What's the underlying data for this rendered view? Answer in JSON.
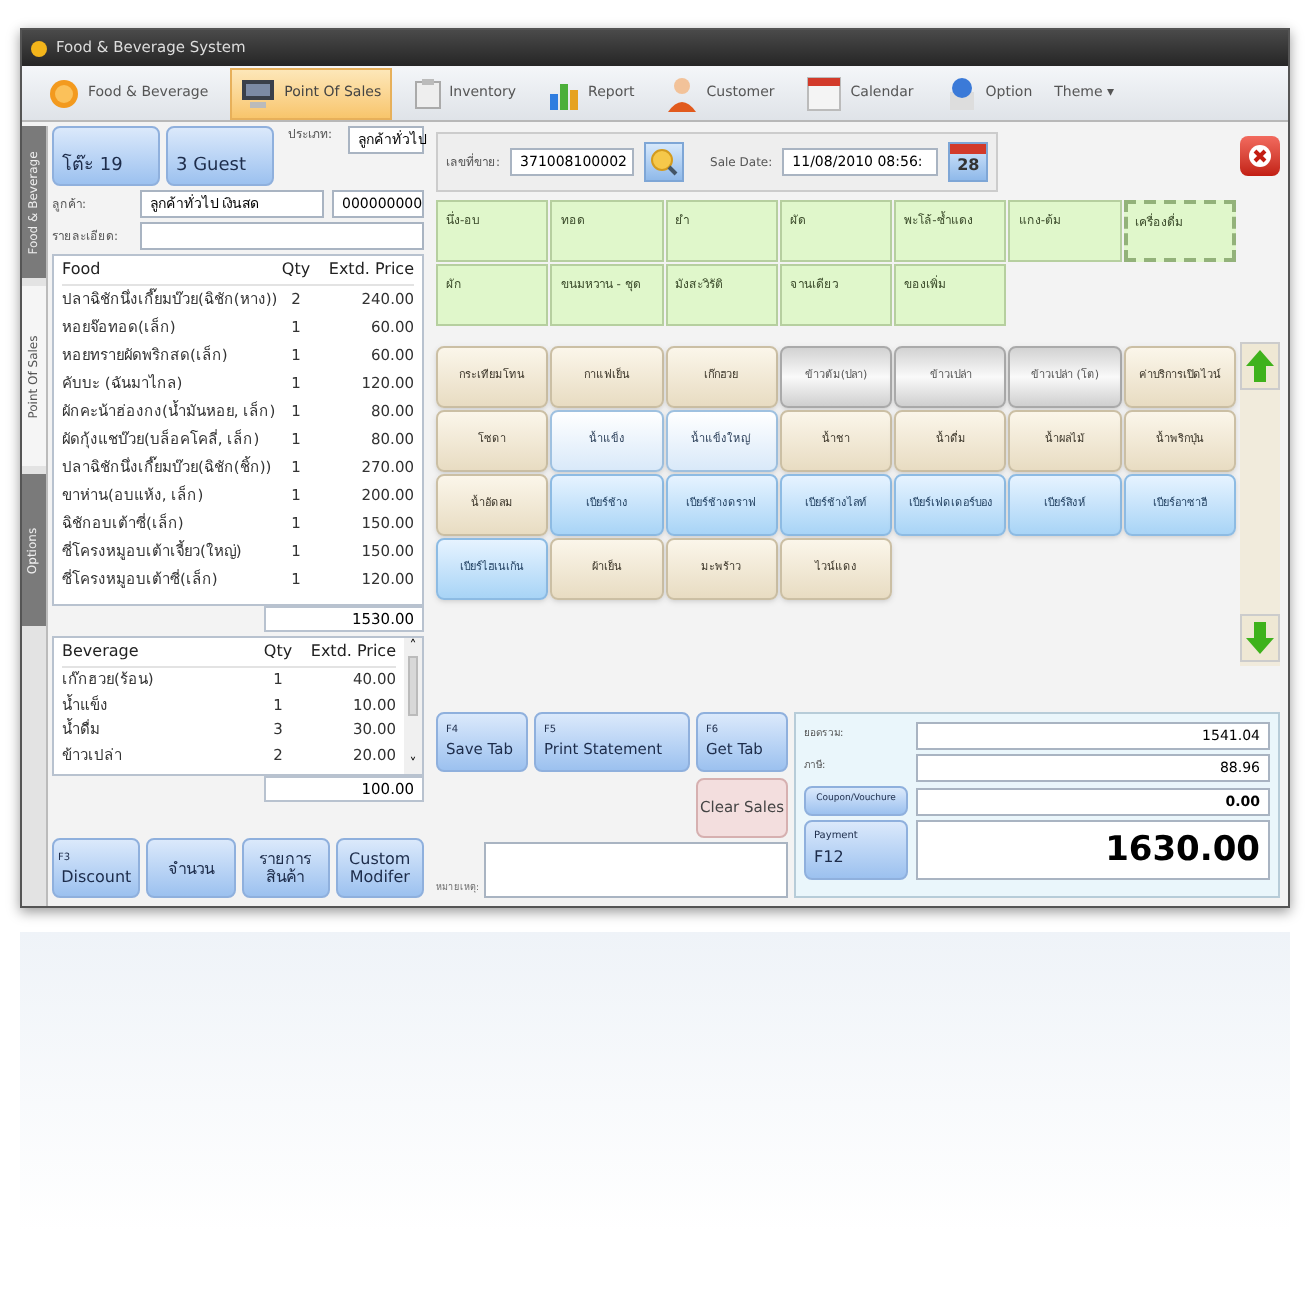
{
  "window": {
    "title": "Food & Beverage System"
  },
  "ribbon": {
    "tabs": [
      {
        "label": "Food & Beverage",
        "selected": false
      },
      {
        "label": "Point Of Sales",
        "selected": true
      },
      {
        "label": "Inventory",
        "selected": false
      },
      {
        "label": "Report",
        "selected": false
      },
      {
        "label": "Customer",
        "selected": false
      },
      {
        "label": "Calendar",
        "selected": false
      },
      {
        "label": "Option",
        "selected": false
      }
    ],
    "theme": {
      "label": "Theme",
      "caret": "▾"
    }
  },
  "side_tabs": [
    {
      "label": "Food & Beverage",
      "selected": false
    },
    {
      "label": "Point Of Sales",
      "selected": true
    },
    {
      "label": "Options",
      "selected": false
    }
  ],
  "order": {
    "table_button": "โต๊ะ 19",
    "guest_button": "3 Guest",
    "type_label": "ประเภท:",
    "type_value": "ลูกค้าทั่วไป",
    "customer_label": "ลูกค้า:",
    "customer_value": "ลูกค้าทั่วไป เงินสด",
    "customer_code": "000000000",
    "detail_label": "รายละเอียด:",
    "food": {
      "columns": [
        "Food",
        "Qty",
        "Extd. Price"
      ],
      "rows": [
        [
          "ปลาฉิชักนึ่งเกี๊ยมบ๊วย(ฉิชัก(หาง))",
          "2",
          "240.00"
        ],
        [
          "หอยจ๊อทอด(เล็ก)",
          "1",
          "60.00"
        ],
        [
          "หอยทรายผัดพริกสด(เล็ก)",
          "1",
          "60.00"
        ],
        [
          "คับบะ (ฉันมาไกล)",
          "1",
          "120.00"
        ],
        [
          "ผักคะน้าฮ่องกง(น้ำมันหอย, เล็ก)",
          "1",
          "80.00"
        ],
        [
          "ผัดกุ้งแชบ๊วย(บล็อคโคลี่, เล็ก)",
          "1",
          "80.00"
        ],
        [
          "ปลาฉิชักนึ่งเกี๊ยมบ๊วย(ฉิชัก(ชิ้ก))",
          "1",
          "270.00"
        ],
        [
          "ขาห่าน(อบแห้ง, เล็ก)",
          "1",
          "200.00"
        ],
        [
          "ฉิชักอบเต้าซี่(เล็ก)",
          "1",
          "150.00"
        ],
        [
          "ซี่โครงหมูอบเต้าเจี้ยว(ใหญ่)",
          "1",
          "150.00"
        ],
        [
          "ซี่โครงหมูอบเต้าซี่(เล็ก)",
          "1",
          "120.00"
        ]
      ],
      "total": "1530.00"
    },
    "beverage": {
      "columns": [
        "Beverage",
        "Qty",
        "Extd. Price"
      ],
      "rows": [
        [
          "เก๊กฮวย(ร้อน)",
          "1",
          "40.00"
        ],
        [
          "น้ำแข็ง",
          "1",
          "10.00"
        ],
        [
          "น้ำดื่ม",
          "3",
          "30.00"
        ],
        [
          "ข้าวเปล่า",
          "2",
          "20.00"
        ]
      ],
      "total": "100.00",
      "scroll_up": "˄",
      "scroll_down": "˅"
    },
    "buttons": [
      {
        "key": "F3",
        "label": "Discount"
      },
      {
        "label": "จำนวน"
      },
      {
        "label": "รายการสินค้า"
      },
      {
        "label": "Custom Modifer"
      }
    ]
  },
  "sale": {
    "number_label": "เลขที่ขาย:",
    "number_value": "371008100002",
    "date_label": "Sale Date:",
    "date_value": "11/08/2010 08:56:",
    "calendar_day": "28"
  },
  "categories": [
    {
      "label": "นึ่ง-อบ",
      "selected": false
    },
    {
      "label": "ทอด",
      "selected": false
    },
    {
      "label": "ยำ",
      "selected": false
    },
    {
      "label": "ผัด",
      "selected": false
    },
    {
      "label": "พะโล้-ซ้ำแดง",
      "selected": false
    },
    {
      "label": "แกง-ต้ม",
      "selected": false
    },
    {
      "label": "เครื่องดื่ม",
      "selected": true
    },
    {
      "label": "ผัก",
      "selected": false
    },
    {
      "label": "ขนมหวาน - ชุด",
      "selected": false
    },
    {
      "label": "มังสะวิรัติ",
      "selected": false
    },
    {
      "label": "จานเดียว",
      "selected": false
    },
    {
      "label": "ของเพิ่ม",
      "selected": false
    }
  ],
  "products": [
    {
      "label": "กระเทียมโทน",
      "kind": "plain"
    },
    {
      "label": "กาแฟเย็น",
      "kind": "plain"
    },
    {
      "label": "เก๊กฮวย",
      "kind": "plain"
    },
    {
      "label": "ข้าวต้ม(ปลา)",
      "kind": "gray"
    },
    {
      "label": "ข้าวเปล่า",
      "kind": "gray"
    },
    {
      "label": "ข้าวเปล่า (โต)",
      "kind": "gray"
    },
    {
      "label": "ค่าบริการเปิดไวน์",
      "kind": "plain"
    },
    {
      "label": "โซดา",
      "kind": "plain"
    },
    {
      "label": "น้ำแข็ง",
      "kind": "ice"
    },
    {
      "label": "น้ำแข็งใหญ่",
      "kind": "ice"
    },
    {
      "label": "น้ำชา",
      "kind": "plain"
    },
    {
      "label": "น้ำดื่ม",
      "kind": "plain"
    },
    {
      "label": "น้ำผลไม้",
      "kind": "plain"
    },
    {
      "label": "น้ำพริกปุ่น",
      "kind": "plain"
    },
    {
      "label": "น้ำอัดลม",
      "kind": "plain"
    },
    {
      "label": "เบียร์ช้าง",
      "kind": "beer"
    },
    {
      "label": "เบียร์ช้างดราฟ",
      "kind": "beer"
    },
    {
      "label": "เบียร์ช้างไลท์",
      "kind": "beer"
    },
    {
      "label": "เบียร์เฟดเดอร์บอง",
      "kind": "beer"
    },
    {
      "label": "เบียร์สิงห์",
      "kind": "beer"
    },
    {
      "label": "เบียร์อาซาฮี",
      "kind": "beer"
    },
    {
      "label": "เบียร์ไฮเนเก้น",
      "kind": "beer"
    },
    {
      "label": "ผ้าเย็น",
      "kind": "plain"
    },
    {
      "label": "มะพร้าว",
      "kind": "plain"
    },
    {
      "label": "ไวน์แดง",
      "kind": "plain"
    }
  ],
  "actions": [
    {
      "key": "F4",
      "label": "Save Tab",
      "kind": "blue"
    },
    {
      "key": "F5",
      "label": "Print Statement",
      "kind": "blue"
    },
    {
      "key": "F6",
      "label": "Get Tab",
      "kind": "blue"
    },
    {
      "label": "Clear Sales",
      "kind": "pink"
    }
  ],
  "note_label": "หมายเหตุ:",
  "summary": {
    "subtotal_label": "ยอดรวม:",
    "subtotal": "1541.04",
    "tax_label": "ภาษี:",
    "tax": "88.96",
    "coupon_button": "Coupon/Vouchure",
    "coupon": "0.00",
    "payment_hint": "Payment",
    "payment_key": "F12",
    "total": "1630.00"
  }
}
